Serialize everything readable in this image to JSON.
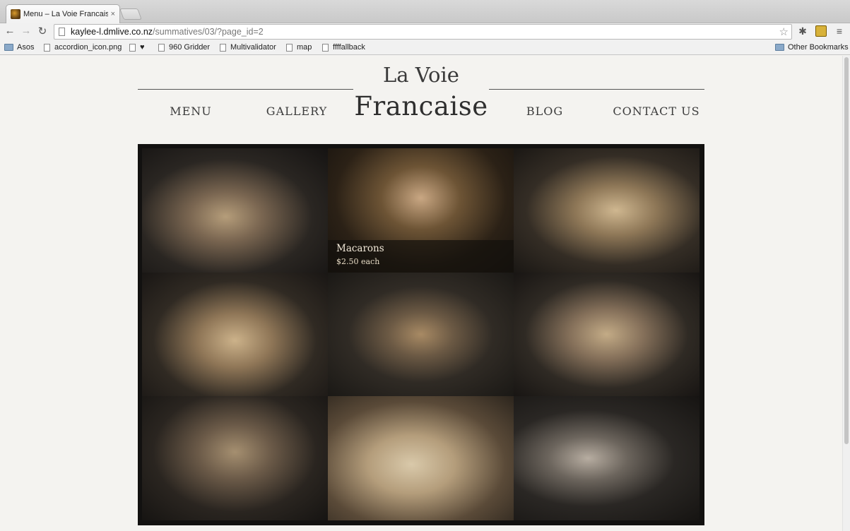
{
  "browser": {
    "tab_title": "Menu – La Voie Francaise",
    "tab_close": "×",
    "url_host": "kaylee-l.dmlive.co.nz",
    "url_path": "/summatives/03/?page_id=2",
    "back": "←",
    "forward": "→",
    "reload": "↻",
    "star": "☆",
    "menu": "≡",
    "bookmarks": [
      {
        "label": "Asos",
        "type": "folder"
      },
      {
        "label": "accordion_icon.png",
        "type": "page"
      },
      {
        "label": "♥",
        "type": "page"
      },
      {
        "label": "960 Gridder",
        "type": "page"
      },
      {
        "label": "Multivalidator",
        "type": "page"
      },
      {
        "label": "map",
        "type": "page"
      },
      {
        "label": "ffffallback",
        "type": "page"
      }
    ],
    "other_bookmarks": "Other Bookmarks"
  },
  "site": {
    "logo_line1": "La Voie",
    "logo_line2": "Francaise",
    "nav": {
      "menu": "MENU",
      "gallery": "GALLERY",
      "blog": "BLOG",
      "contact": "CONTACT US"
    },
    "gallery": {
      "caption_title": "Macarons",
      "caption_price": "$2.50 each"
    }
  },
  "colors": {
    "page_bg": "#f4f3f0",
    "gallery_bg": "#121110",
    "nav_text": "#3c3c3c"
  }
}
